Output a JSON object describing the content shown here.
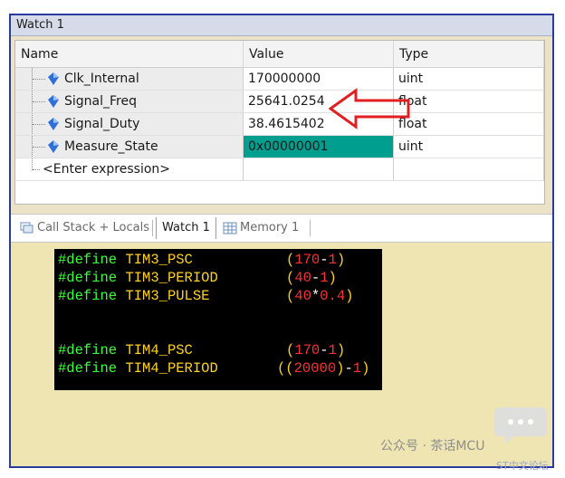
{
  "window": {
    "title": "Watch 1"
  },
  "columns": {
    "name": "Name",
    "value": "Value",
    "type": "Type"
  },
  "rows": [
    {
      "name": "Clk_Internal",
      "value": "170000000",
      "type": "uint"
    },
    {
      "name": "Signal_Freq",
      "value": "25641.0254",
      "type": "float"
    },
    {
      "name": "Signal_Duty",
      "value": "38.4615402",
      "type": "float"
    },
    {
      "name": "Measure_State",
      "value": "0x00000001",
      "type": "uint"
    }
  ],
  "enter_expression": "<Enter expression>",
  "tabs": [
    {
      "label": "Call Stack + Locals",
      "active": false
    },
    {
      "label": "Watch 1",
      "active": true
    },
    {
      "label": "Memory 1",
      "active": false
    }
  ],
  "code": [
    {
      "kw": "#define",
      "id": "TIM3_PSC",
      "tokens": [
        [
          "paren",
          "("
        ],
        [
          "num",
          "170"
        ],
        [
          "op",
          "-"
        ],
        [
          "num",
          "1"
        ],
        [
          "paren",
          ")"
        ]
      ]
    },
    {
      "kw": "#define",
      "id": "TIM3_PERIOD",
      "tokens": [
        [
          "paren",
          "("
        ],
        [
          "num",
          "40"
        ],
        [
          "op",
          "-"
        ],
        [
          "num",
          "1"
        ],
        [
          "paren",
          ")"
        ]
      ]
    },
    {
      "kw": "#define",
      "id": "TIM3_PULSE",
      "tokens": [
        [
          "paren",
          "("
        ],
        [
          "num",
          "40"
        ],
        [
          "op",
          "*"
        ],
        [
          "num",
          "0.4"
        ],
        [
          "paren",
          ")"
        ]
      ]
    },
    {
      "kw": "#define",
      "id": "TIM4_PSC",
      "tokens": [
        [
          "paren",
          "("
        ],
        [
          "num",
          "170"
        ],
        [
          "op",
          "-"
        ],
        [
          "num",
          "1"
        ],
        [
          "paren",
          ")"
        ]
      ]
    },
    {
      "kw": "#define",
      "id": "TIM4_PERIOD",
      "tokens": [
        [
          "paren",
          "(("
        ],
        [
          "num",
          "20000"
        ],
        [
          "paren",
          ")"
        ],
        [
          "op",
          "-"
        ],
        [
          "num",
          "1"
        ],
        [
          "paren",
          ")"
        ]
      ]
    }
  ],
  "colors": {
    "highlight_cell": "#009e8e",
    "arrow": "#e02020",
    "frame_border": "#2b3a9e"
  },
  "annotation": {
    "arrow_icon": "red-arrow-left-icon"
  },
  "watermark": {
    "text": "公众号 · 茶话MCU",
    "sub": "ST中文论坛"
  }
}
